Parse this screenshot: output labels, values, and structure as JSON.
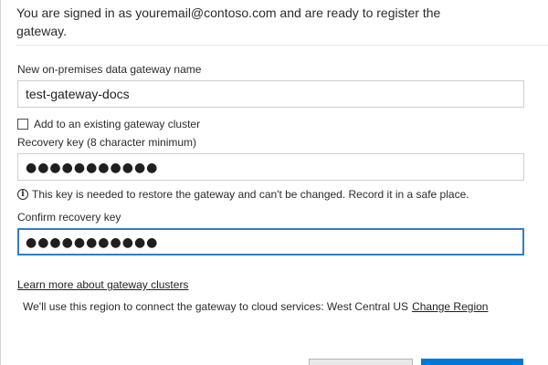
{
  "header": {
    "message": "You are signed in as youremail@contoso.com and are ready to register the gateway."
  },
  "form": {
    "gateway_name": {
      "label": "New on-premises data gateway name",
      "value": "test-gateway-docs"
    },
    "add_to_cluster": {
      "label": "Add to an existing gateway cluster",
      "checked": false
    },
    "recovery_key": {
      "label": "Recovery key (8 character minimum)",
      "masked_value": "●●●●●●●●●●●"
    },
    "info_note": "This key is needed to restore the gateway and can't be changed. Record it in a safe place.",
    "confirm_key": {
      "label": "Confirm recovery key",
      "masked_value": "●●●●●●●●●●●"
    }
  },
  "links": {
    "learn_more": "Learn more about gateway clusters"
  },
  "region": {
    "text": "We'll use this region to connect the gateway to cloud services: West Central US",
    "change_label": "Change Region"
  },
  "colors": {
    "accent": "#0078d4",
    "focus_border": "#2f7fc5"
  }
}
